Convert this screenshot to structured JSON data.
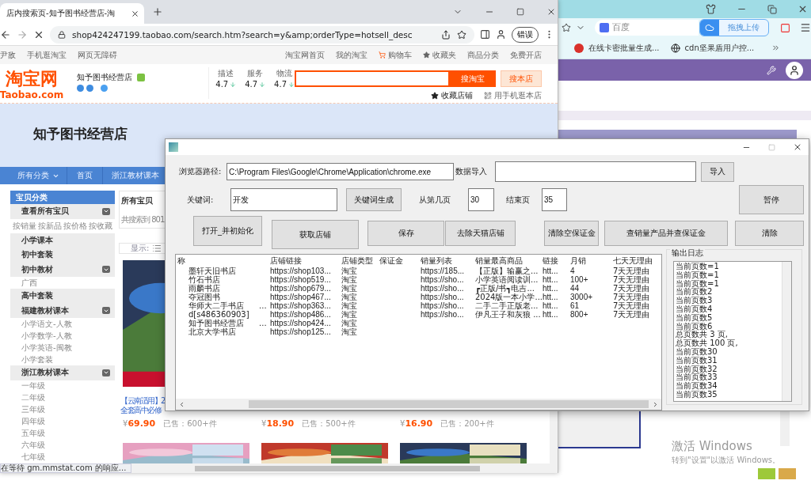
{
  "left_browser": {
    "tab_title": "店内搜索页-知予图书经营店-淘",
    "url": "shop424247199.taobao.com/search.htm?search=y&amp;orderType=hotsell_desc",
    "profile_button": "错误",
    "site_nav": {
      "left": [
        "尹敌",
        "手机逛淘宝",
        "网页无障碍"
      ],
      "right": [
        "淘宝网首页",
        "我的淘宝",
        "购物车",
        "收藏夹",
        "商品分类",
        "免费开店"
      ]
    },
    "logo": {
      "name": "淘宝网",
      "domain": "Taobao.com"
    },
    "shop": {
      "name": "知予图书经营店",
      "ratings": [
        {
          "label": "描述",
          "score": "4.7"
        },
        {
          "label": "服务",
          "score": "4.7"
        },
        {
          "label": "物流",
          "score": "4.7"
        }
      ]
    },
    "search_buttons": [
      "搜淘宝",
      "搜本店"
    ],
    "shop_links": [
      "收藏店铺",
      "用手机逛本店"
    ],
    "banner_title": "知予图书经营店",
    "nav": [
      {
        "label": "所有分类",
        "has_caret": true
      },
      {
        "label": "首页",
        "has_caret": false
      },
      {
        "label": "浙江教材课本",
        "has_caret": false
      }
    ],
    "sidebar": {
      "title": "宝贝分类",
      "groups": [
        {
          "label": "查看所有宝贝",
          "kind": "inline",
          "children": [
            "按销量",
            "按新品",
            "按价格",
            "按收藏"
          ]
        },
        {
          "label": "小学课本",
          "kind": "list"
        },
        {
          "label": "初中套装",
          "kind": "list"
        },
        {
          "label": "初中教材",
          "kind": "list",
          "children": [
            "广西"
          ]
        },
        {
          "label": "高中套装",
          "kind": "list"
        },
        {
          "label": "福建教材课本",
          "kind": "list",
          "children": [
            "小学语文-人教",
            "小学数学-人教",
            "小学英语-闽教",
            "小学套装"
          ]
        },
        {
          "label": "浙江教材课本",
          "kind": "list",
          "children": [
            "一年级",
            "二年级",
            "三年级",
            "四年级",
            "五年级",
            "六年级",
            "七年级"
          ]
        }
      ]
    },
    "main": {
      "heading": "所有宝贝",
      "result_count": "共搜索到 801",
      "display_label": "显示:",
      "products": [
        {
          "title_lines": [
            "【云南适用】2",
            "全套高中必修"
          ],
          "currency": "¥",
          "price": "69.90",
          "sold": "已售：600+件"
        },
        {
          "currency": "¥",
          "price": "18.90",
          "sold": "已售：500+件"
        },
        {
          "currency": "¥",
          "price": "16.90",
          "sold": "已售：200+件"
        }
      ]
    },
    "status": "在等待 gm.mmstat.com 的响应..."
  },
  "right_browser": {
    "search_placeholder": "百度",
    "upload_button": "拖拽上传",
    "bookmarks": [
      "在线卡密批量生成...",
      "cdn坚果盾用户控..."
    ]
  },
  "dialog": {
    "browser_path": {
      "label": "浏览器路径:",
      "value": "C:\\Program Files\\Google\\Chrome\\Application\\chrome.exe"
    },
    "data_import": {
      "label": "数据导入",
      "button": "导入"
    },
    "keyword": {
      "label": "关键词:",
      "value": "开发",
      "button": "关键词生成"
    },
    "start_page": {
      "label": "从第几页",
      "value": "30"
    },
    "end_page": {
      "label": "结束页",
      "value": "35"
    },
    "pause_button": "暂停",
    "actions": [
      "打开_并初始化",
      "获取店铺",
      "保存",
      "去除天猫店铺",
      "清除空保证金",
      "查销量产品并查保证金",
      "清除"
    ],
    "table": {
      "columns": [
        "称",
        "店铺链接",
        "店铺类型",
        "保证金",
        "销量列表",
        "销量最高商品",
        "链接",
        "月销",
        "七天无理由"
      ],
      "rows": [
        [
          "墨轩天旧书店",
          "https://shop103...",
          "淘宝",
          null,
          "https://185...",
          "【正版】输赢之...",
          "htt...",
          "4",
          "7天无理由"
        ],
        [
          "竹石书店",
          "https://shop519...",
          "淘宝",
          null,
          "https://sho...",
          "小学英语阅读训...",
          "htt...",
          "100+",
          "7天无理由"
        ],
        [
          "雨麟书店",
          "https://shop679...",
          "淘宝",
          null,
          "https://sho...",
          "┏正版/书┓电吉...",
          "htt...",
          "44",
          "7天无理由"
        ],
        [
          "夺冠图书",
          "https://shop467...",
          "淘宝",
          null,
          "https://sho...",
          "2024版一本小学...",
          "htt...",
          "3000+",
          "7天无理由"
        ],
        [
          "华师大二手书店      ...",
          "https://shop363...",
          "淘宝",
          null,
          "https://sho...",
          "二手二手正版老...",
          "htt...",
          "61",
          "7天无理由"
        ],
        [
          "d[s486360903]",
          "https://shop486...",
          "淘宝",
          null,
          "https://sho...",
          "伊凡王子和灰狼 ...",
          "htt...",
          "800+",
          "7天无理由"
        ],
        [
          "知予图书经营店      ...",
          "https://shop424...",
          "淘宝",
          null,
          null,
          null,
          null,
          null,
          null
        ],
        [
          "北京大学书店",
          "https://shop125...",
          "淘宝",
          null,
          null,
          null,
          null,
          null,
          null
        ]
      ]
    },
    "log": {
      "title": "输出日志",
      "lines": [
        "当前页数=1",
        "当前页数=1",
        "当前页数=1",
        "当前页数2",
        "当前页数3",
        "当前页数4",
        "当前页数5",
        "当前页数6",
        "总页数共 3 页,",
        "总页数共 100 页,",
        "当前页数30",
        "当前页数31",
        "当前页数32",
        "当前页数33",
        "当前页数34",
        "当前页数35"
      ]
    }
  },
  "windows_notice": {
    "title": "激活 Windows",
    "hint": "转到\"设置\"以激活 Windows。"
  }
}
